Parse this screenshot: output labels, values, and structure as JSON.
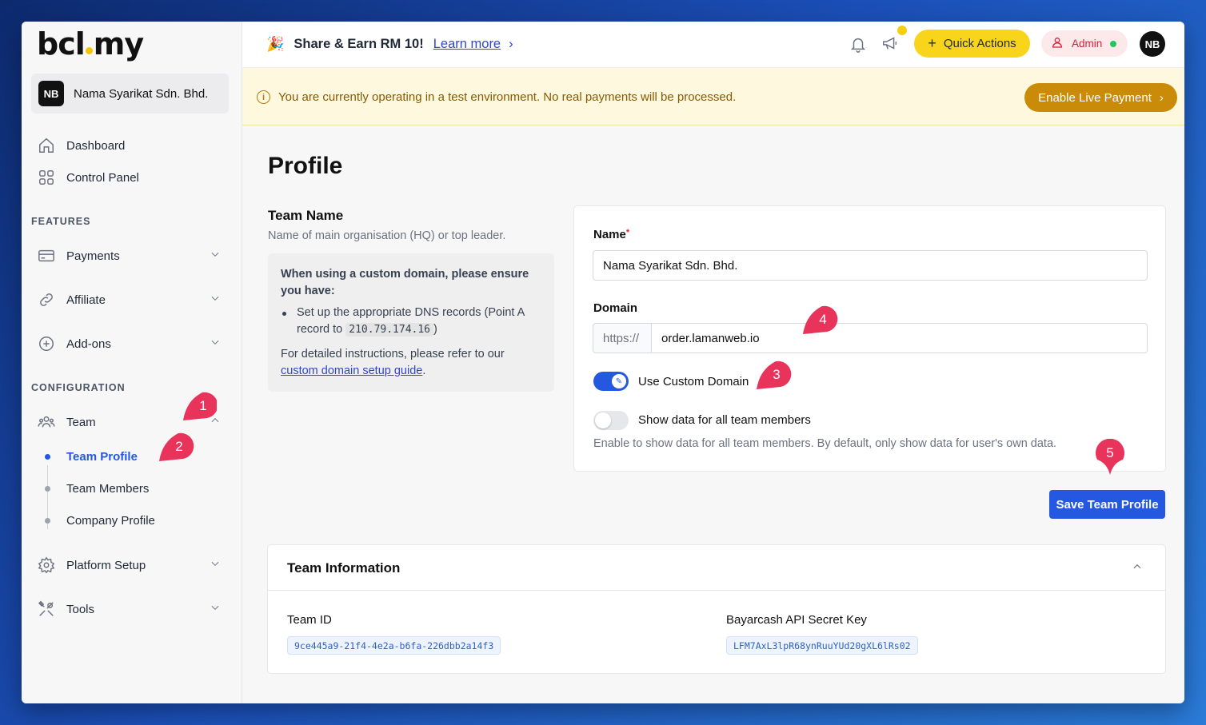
{
  "brand": {
    "logo_left": "bcl",
    "logo_right": "my",
    "accent": "#f5c400"
  },
  "org": {
    "initials": "NB",
    "name": "Nama Syarikat Sdn. Bhd."
  },
  "sidebar": {
    "top_items": [
      {
        "label": "Dashboard",
        "icon": "home-icon"
      },
      {
        "label": "Control Panel",
        "icon": "grid-icon"
      }
    ],
    "features_label": "FEATURES",
    "feature_items": [
      {
        "label": "Payments",
        "icon": "card-icon"
      },
      {
        "label": "Affiliate",
        "icon": "link-icon"
      },
      {
        "label": "Add-ons",
        "icon": "plus-circle-icon"
      }
    ],
    "configuration_label": "CONFIGURATION",
    "team": {
      "label": "Team",
      "icon": "users-icon",
      "subitems": [
        {
          "label": "Team Profile",
          "active": true
        },
        {
          "label": "Team Members",
          "active": false
        },
        {
          "label": "Company Profile",
          "active": false
        }
      ]
    },
    "bottom_items": [
      {
        "label": "Platform Setup",
        "icon": "settings-icon"
      },
      {
        "label": "Tools",
        "icon": "tools-icon"
      }
    ]
  },
  "topbar": {
    "promo_title": "Share & Earn RM 10!",
    "promo_link": "Learn more",
    "quick_actions": "Quick Actions",
    "admin_label": "Admin",
    "avatar_initials": "NB"
  },
  "banner": {
    "message": "You are currently operating in a test environment. No real payments will be processed.",
    "button": "Enable Live Payment"
  },
  "page": {
    "title": "Profile",
    "team_name_heading": "Team Name",
    "team_name_desc": "Name of main organisation (HQ) or top leader.",
    "note": {
      "heading": "When using a custom domain, please ensure you have:",
      "bullet_prefix": "Set up the appropriate DNS records (Point A record to",
      "ip": "210.79.174.16",
      "bullet_suffix": ")",
      "instructions": "For detailed instructions, please refer to our",
      "link": "custom domain setup guide",
      "link_suffix": "."
    },
    "form": {
      "name_label": "Name",
      "name_required": "*",
      "name_value": "Nama Syarikat Sdn. Bhd.",
      "domain_label": "Domain",
      "domain_prefix": "https://",
      "domain_value": "order.lamanweb.io",
      "custom_domain_label": "Use Custom Domain",
      "custom_domain_on": true,
      "show_data_label": "Show data for all team members",
      "show_data_on": false,
      "show_data_hint": "Enable to show data for all team members. By default, only show data for user's own data."
    },
    "save_button": "Save Team Profile",
    "team_info": {
      "heading": "Team Information",
      "team_id_label": "Team ID",
      "team_id_value": "9ce445a9-21f4-4e2a-b6fa-226dbb2a14f3",
      "api_key_label": "Bayarcash API Secret Key",
      "api_key_value": "LFM7AxL3lpR68ynRuuYUd20gXL6lRs02"
    }
  },
  "callouts": [
    "1",
    "2",
    "3",
    "4",
    "5"
  ],
  "colors": {
    "primary": "#2458e0",
    "callout": "#e8335a",
    "quick_actions_bg": "#f8d41b",
    "live_btn": "#c98b08"
  }
}
